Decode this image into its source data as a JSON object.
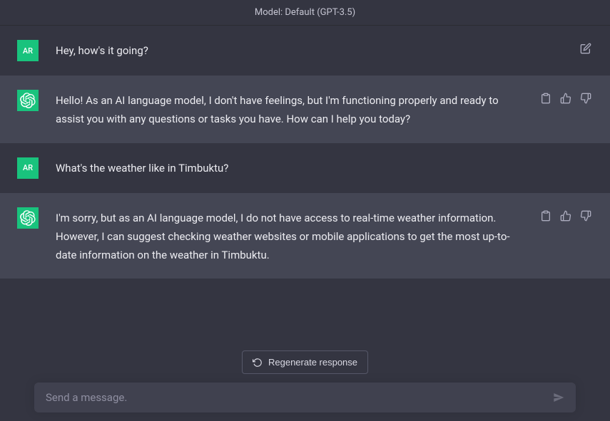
{
  "header": {
    "model_label": "Model: Default (GPT-3.5)"
  },
  "user": {
    "initials": "AR"
  },
  "messages": [
    {
      "role": "user",
      "text": "Hey, how's it going?"
    },
    {
      "role": "assistant",
      "text": "Hello! As an AI language model, I don't have feelings, but I'm functioning properly and ready to assist you with any questions or tasks you have. How can I help you today?"
    },
    {
      "role": "user",
      "text": "What's the weather like in Timbuktu?"
    },
    {
      "role": "assistant",
      "text": "I'm sorry, but as an AI language model, I do not have access to real-time weather information. However, I can suggest checking weather websites or mobile applications to get the most up-to-date information on the weather in Timbuktu."
    }
  ],
  "controls": {
    "regenerate_label": "Regenerate response",
    "input_placeholder": "Send a message."
  }
}
